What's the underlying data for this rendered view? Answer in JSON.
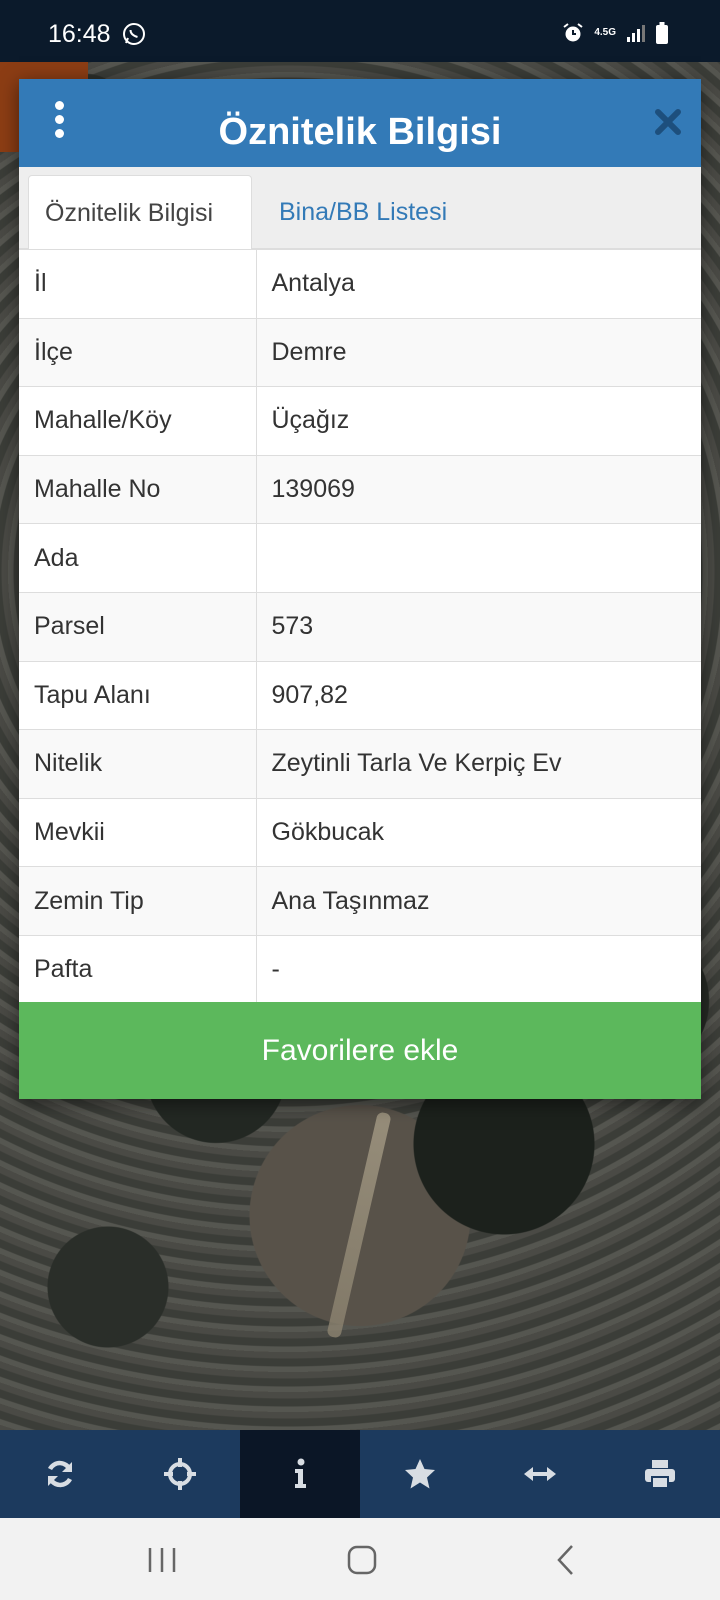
{
  "status_bar": {
    "time": "16:48",
    "network": "4.5G"
  },
  "modal": {
    "title": "Öznitelik Bilgisi",
    "tabs": [
      {
        "label": "Öznitelik Bilgisi",
        "active": true
      },
      {
        "label": "Bina/BB Listesi",
        "active": false
      }
    ],
    "rows": [
      {
        "key": "İl",
        "value": "Antalya"
      },
      {
        "key": "İlçe",
        "value": "Demre"
      },
      {
        "key": "Mahalle/Köy",
        "value": "Üçağız"
      },
      {
        "key": "Mahalle No",
        "value": "139069"
      },
      {
        "key": "Ada",
        "value": ""
      },
      {
        "key": "Parsel",
        "value": "573"
      },
      {
        "key": "Tapu Alanı",
        "value": "907,82"
      },
      {
        "key": "Nitelik",
        "value": "Zeytinli Tarla Ve Kerpiç Ev"
      },
      {
        "key": "Mevkii",
        "value": "Gökbucak"
      },
      {
        "key": "Zemin Tip",
        "value": "Ana Taşınmaz"
      },
      {
        "key": "Pafta",
        "value": "-"
      }
    ],
    "favorite_button": "Favorilere ekle"
  },
  "toolbar": {
    "items": [
      {
        "icon": "refresh-icon",
        "active": false
      },
      {
        "icon": "crosshairs-icon",
        "active": false
      },
      {
        "icon": "info-icon",
        "active": true
      },
      {
        "icon": "star-icon",
        "active": false
      },
      {
        "icon": "measure-arrows-icon",
        "active": false
      },
      {
        "icon": "print-icon",
        "active": false
      }
    ]
  },
  "colors": {
    "header": "#337ab7",
    "button": "#5cb85c",
    "toolbar": "#1c3a5e",
    "toolbar_active": "#0b1626"
  }
}
